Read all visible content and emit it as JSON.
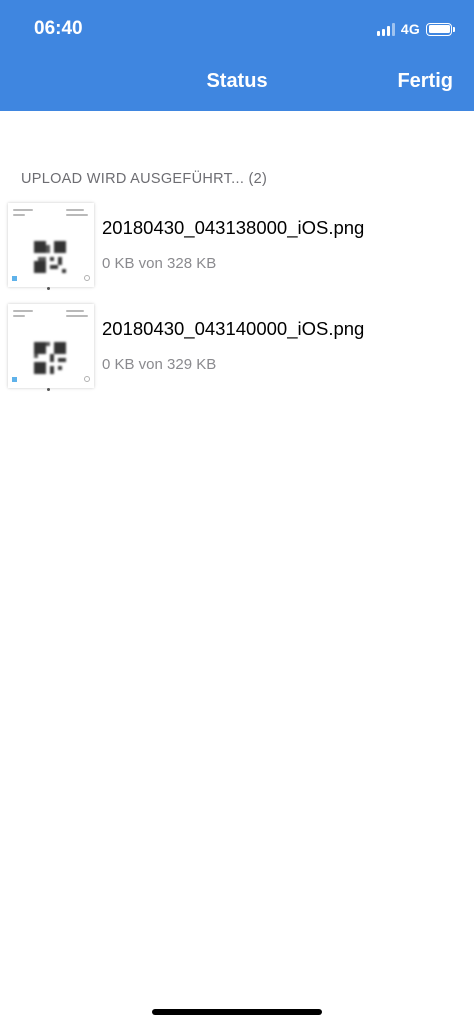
{
  "status_bar": {
    "time": "06:40",
    "network": "4G",
    "signal_icon": "signal-bars-icon",
    "battery_icon": "battery-icon"
  },
  "nav": {
    "title": "Status",
    "done_label": "Fertig",
    "background_color": "#3f86e0"
  },
  "section": {
    "header": "UPLOAD WIRD AUSGEFÜHRT... (2)"
  },
  "uploads": [
    {
      "file_name": "20180430_043138000_iOS.png",
      "progress": "0 KB von 328 KB"
    },
    {
      "file_name": "20180430_043140000_iOS.png",
      "progress": "0 KB von 329 KB"
    }
  ]
}
